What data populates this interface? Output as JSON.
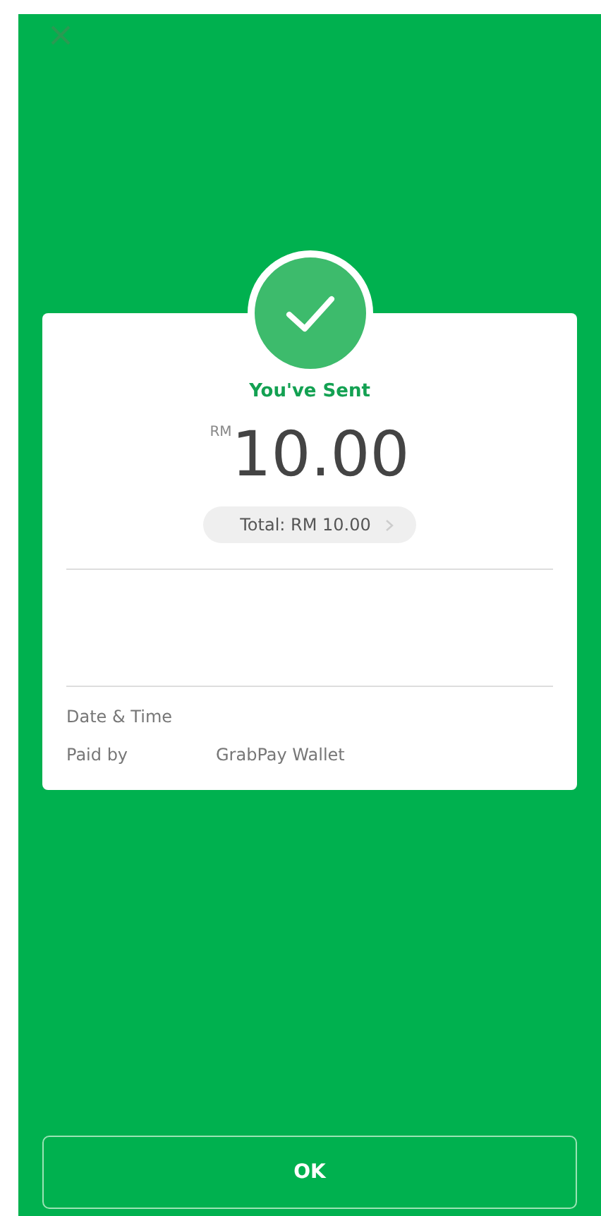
{
  "title": "You've Sent",
  "amount": {
    "currency": "RM",
    "value": "10.00"
  },
  "total": "Total: RM 10.00",
  "details": [
    {
      "label": "Date & Time"
    },
    {
      "label": "Paid by",
      "value": "GrabPay Wallet"
    }
  ],
  "button": "OK"
}
